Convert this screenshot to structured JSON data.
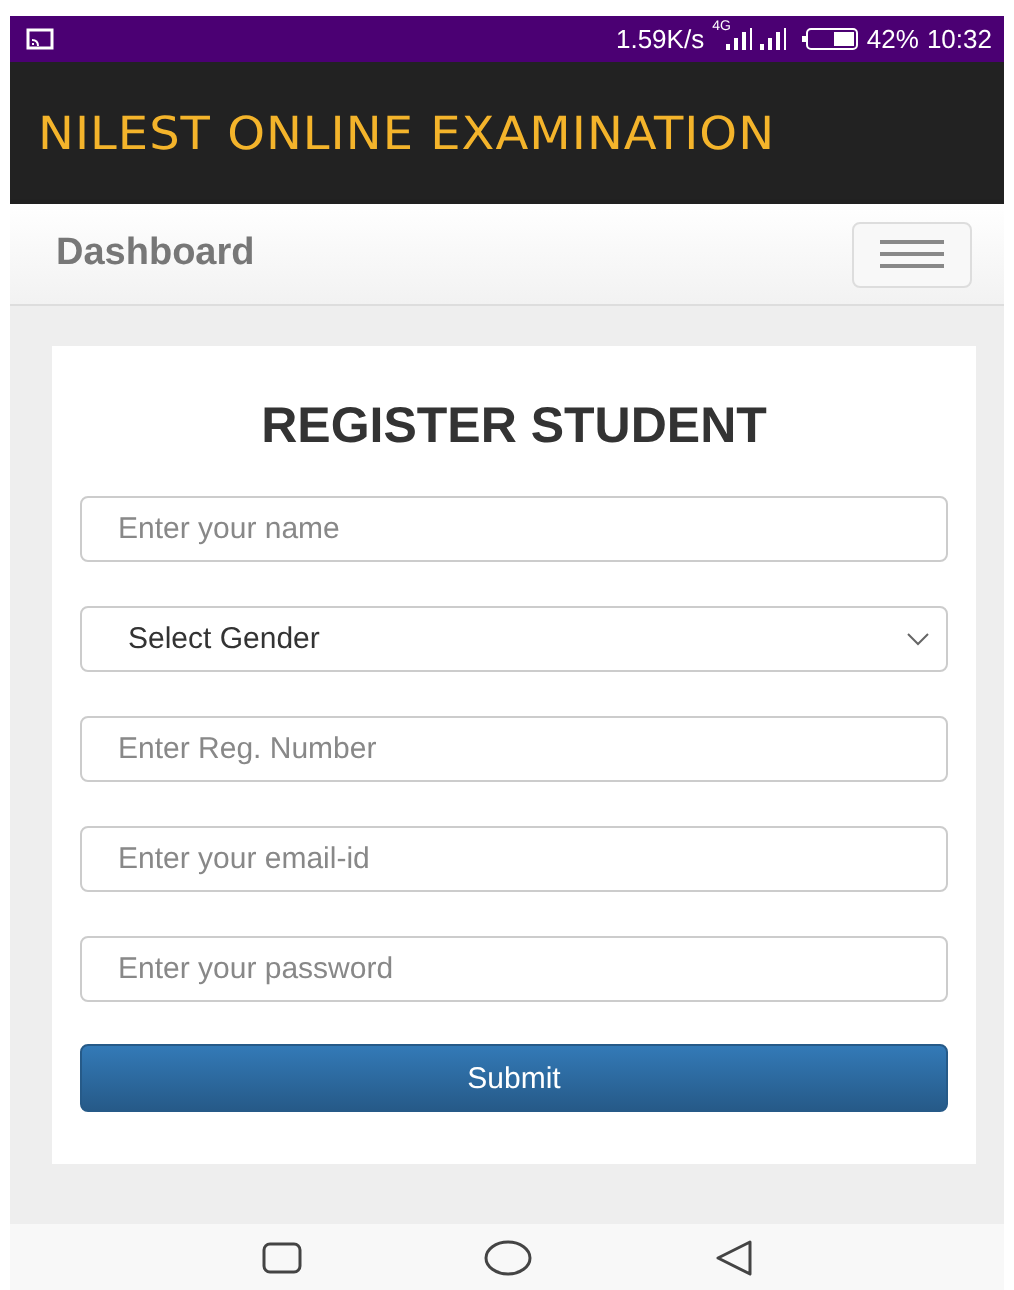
{
  "status_bar": {
    "speed": "1.59K/s",
    "network": "4G",
    "battery": "42%",
    "time": "10:32"
  },
  "header": {
    "title": "NILEST ONLINE EXAMINATION"
  },
  "navbar": {
    "brand": "Dashboard"
  },
  "form": {
    "title": "REGISTER STUDENT",
    "fields": [
      {
        "kind": "input",
        "placeholder": "Enter your name"
      },
      {
        "kind": "select",
        "value": "Select Gender"
      },
      {
        "kind": "input",
        "placeholder": "Enter Reg. Number"
      },
      {
        "kind": "input",
        "placeholder": "Enter your email-id"
      },
      {
        "kind": "input",
        "placeholder": "Enter your password"
      }
    ],
    "submit": "Submit"
  }
}
